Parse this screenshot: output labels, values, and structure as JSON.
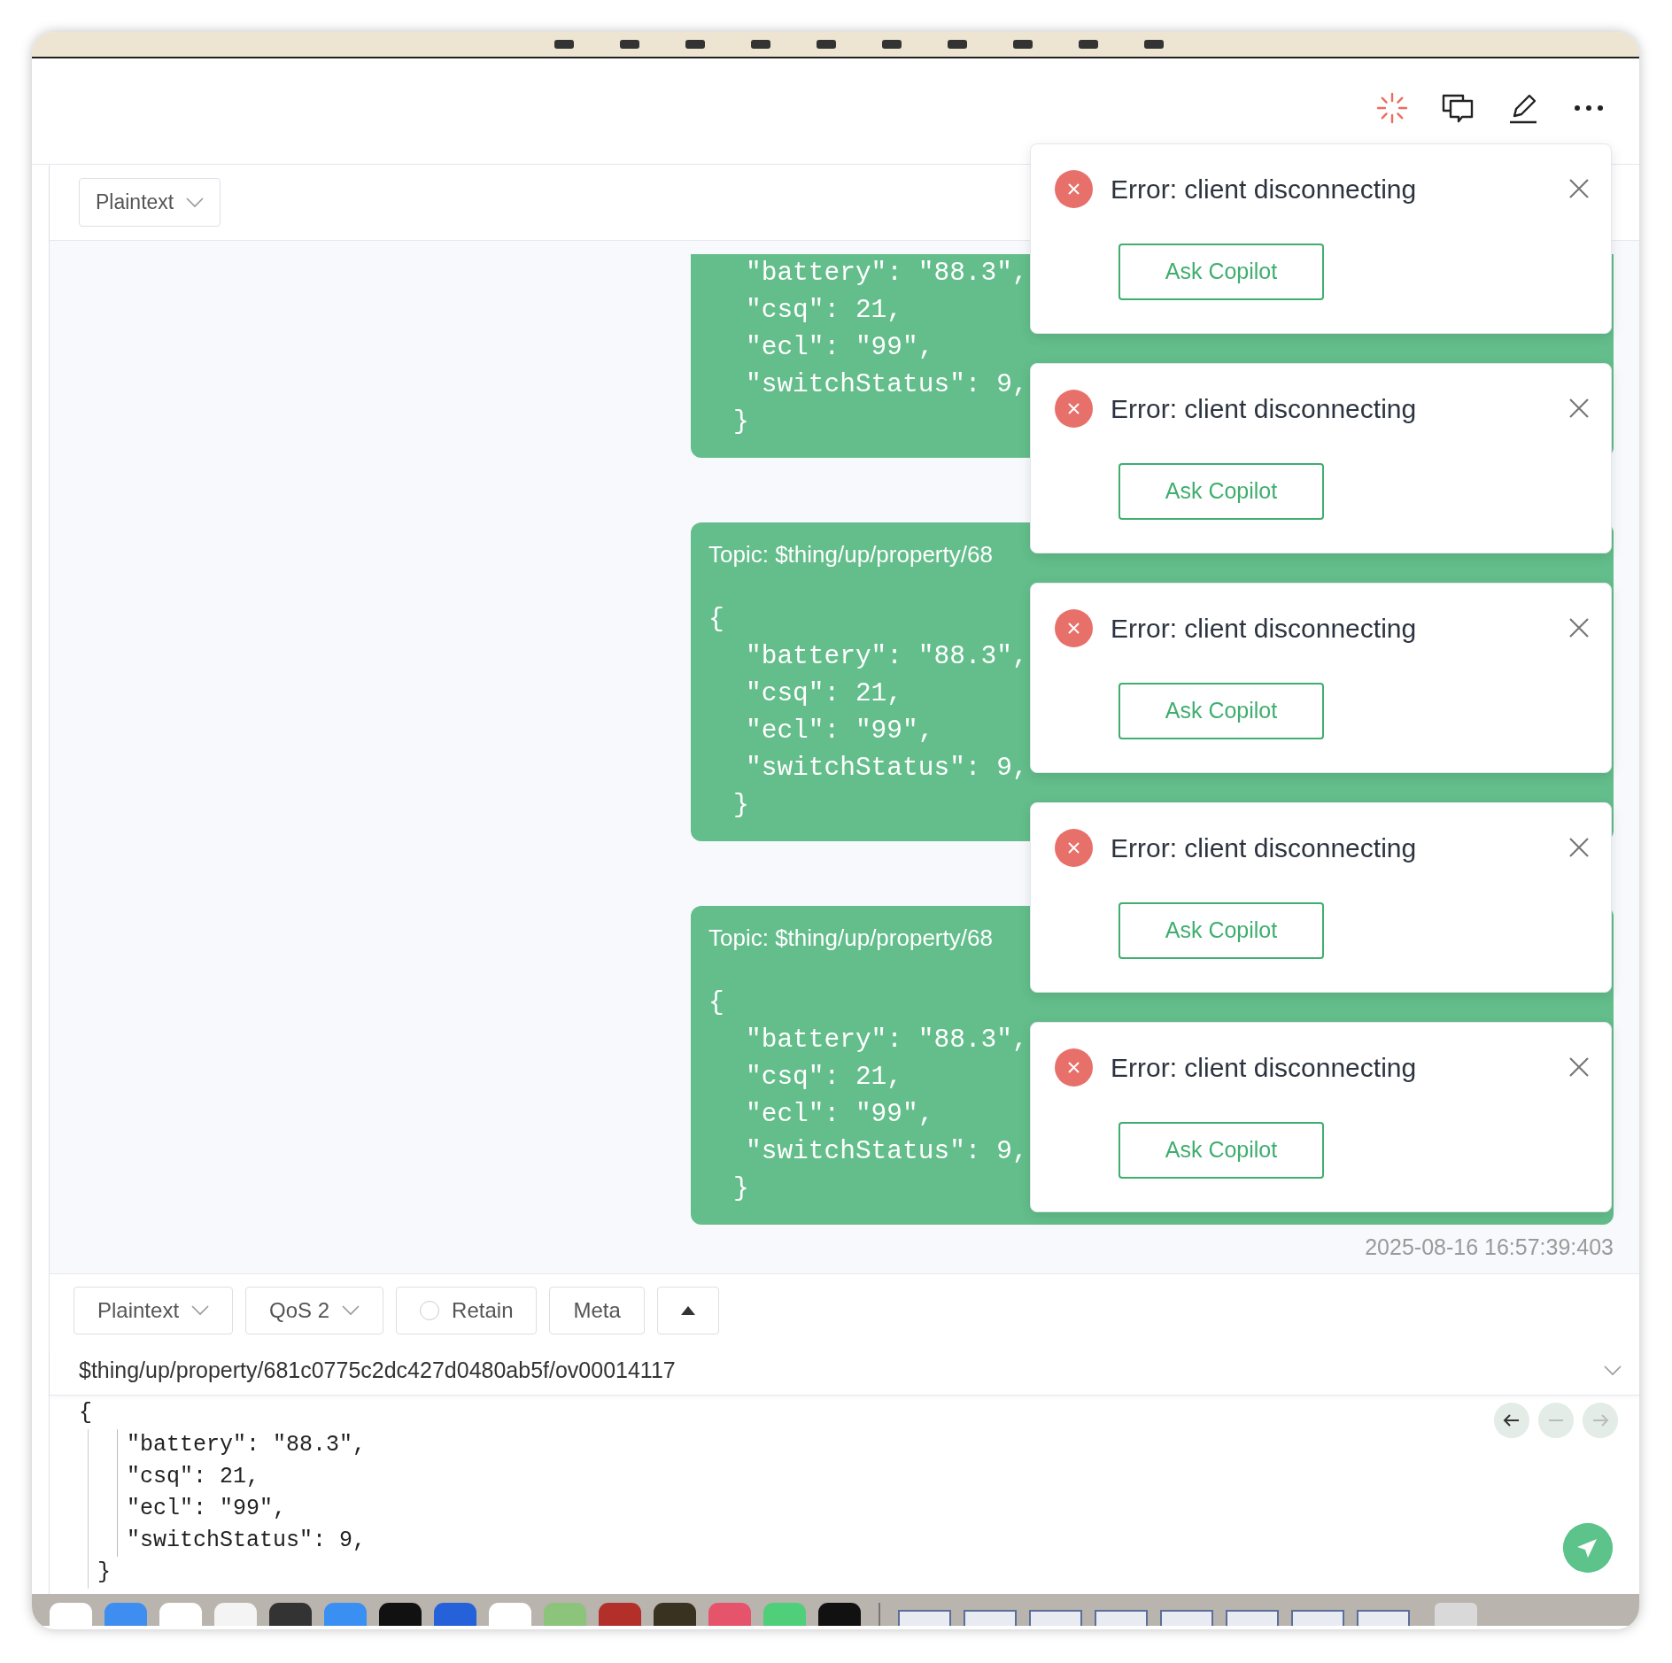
{
  "toolbar": {
    "format": "Plaintext"
  },
  "messages": [
    {
      "payload": {
        "lines": [
          "\"battery\": \"88.3\",",
          "\"csq\": 21,",
          "\"ecl\": \"99\",",
          "\"switchStatus\": 9,"
        ],
        "close": "}"
      }
    },
    {
      "topic": "Topic: $thing/up/property/68",
      "payload": {
        "open": "{",
        "lines": [
          "\"battery\": \"88.3\",",
          "\"csq\": 21,",
          "\"ecl\": \"99\",",
          "\"switchStatus\": 9,"
        ],
        "close": "}"
      }
    },
    {
      "topic": "Topic: $thing/up/property/68",
      "payload": {
        "open": "{",
        "lines": [
          "\"battery\": \"88.3\",",
          "\"csq\": 21,",
          "\"ecl\": \"99\",",
          "\"switchStatus\": 9,"
        ],
        "close": "}"
      }
    }
  ],
  "timestamp": "2025-08-16 16:57:39:403",
  "toasts": [
    {
      "message": "Error: client disconnecting",
      "action": "Ask Copilot"
    },
    {
      "message": "Error: client disconnecting",
      "action": "Ask Copilot"
    },
    {
      "message": "Error: client disconnecting",
      "action": "Ask Copilot"
    },
    {
      "message": "Error: client disconnecting",
      "action": "Ask Copilot"
    },
    {
      "message": "Error: client disconnecting",
      "action": "Ask Copilot"
    }
  ],
  "composer": {
    "format": "Plaintext",
    "qos": "QoS 2",
    "retain": {
      "label": "Retain",
      "checked": false
    },
    "meta": "Meta",
    "topic": "$thing/up/property/681c0775c2dc427d0480ab5f/ov00014117",
    "payload": {
      "open": "{",
      "lines": [
        "\"battery\": \"88.3\",",
        "\"csq\": 21,",
        "\"ecl\": \"99\",",
        "\"switchStatus\": 9,"
      ],
      "close": "}"
    }
  }
}
